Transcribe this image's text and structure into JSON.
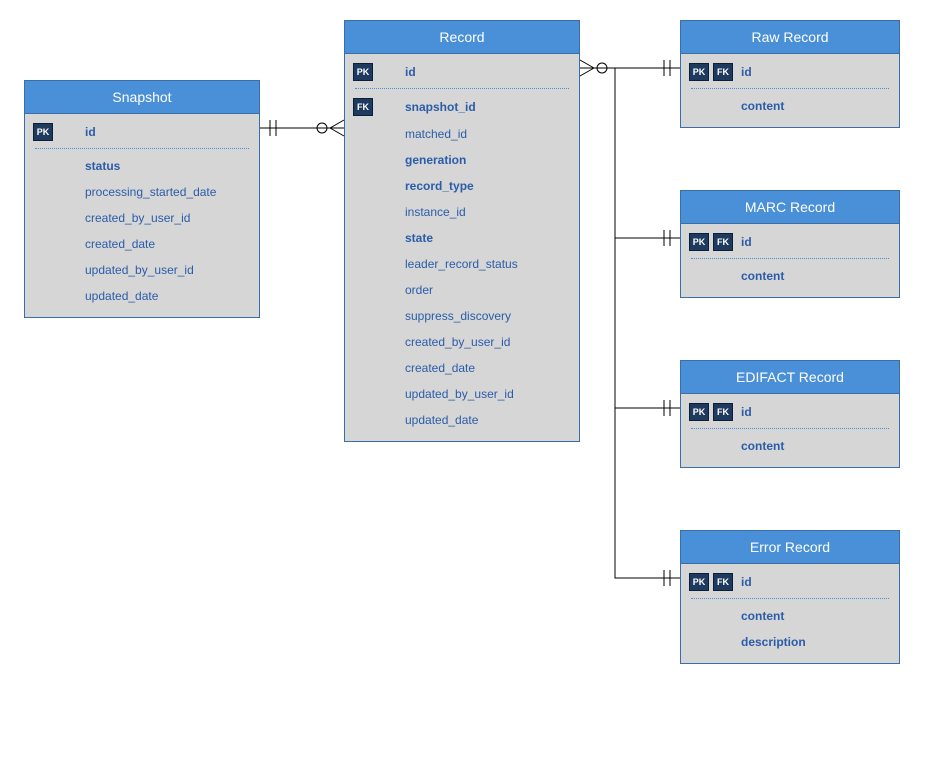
{
  "entities": {
    "snapshot": {
      "title": "Snapshot",
      "fields": [
        {
          "keys": [
            "PK"
          ],
          "name": "id",
          "bold": true
        },
        {
          "sep": true
        },
        {
          "keys": [],
          "name": "status",
          "bold": true
        },
        {
          "keys": [],
          "name": "processing_started_date",
          "bold": false
        },
        {
          "keys": [],
          "name": "created_by_user_id",
          "bold": false
        },
        {
          "keys": [],
          "name": "created_date",
          "bold": false
        },
        {
          "keys": [],
          "name": "updated_by_user_id",
          "bold": false
        },
        {
          "keys": [],
          "name": "updated_date",
          "bold": false
        }
      ]
    },
    "record": {
      "title": "Record",
      "fields": [
        {
          "keys": [
            "PK"
          ],
          "name": "id",
          "bold": true
        },
        {
          "sep": true
        },
        {
          "keys": [
            "FK"
          ],
          "name": "snapshot_id",
          "bold": true
        },
        {
          "keys": [],
          "name": "matched_id",
          "bold": false
        },
        {
          "keys": [],
          "name": "generation",
          "bold": true
        },
        {
          "keys": [],
          "name": "record_type",
          "bold": true
        },
        {
          "keys": [],
          "name": "instance_id",
          "bold": false
        },
        {
          "keys": [],
          "name": "state",
          "bold": true
        },
        {
          "keys": [],
          "name": "leader_record_status",
          "bold": false
        },
        {
          "keys": [],
          "name": "order",
          "bold": false
        },
        {
          "keys": [],
          "name": "suppress_discovery",
          "bold": false
        },
        {
          "keys": [],
          "name": "created_by_user_id",
          "bold": false
        },
        {
          "keys": [],
          "name": "created_date",
          "bold": false
        },
        {
          "keys": [],
          "name": "updated_by_user_id",
          "bold": false
        },
        {
          "keys": [],
          "name": "updated_date",
          "bold": false
        }
      ]
    },
    "raw": {
      "title": "Raw Record",
      "fields": [
        {
          "keys": [
            "PK",
            "FK"
          ],
          "name": "id",
          "bold": true
        },
        {
          "sep": true
        },
        {
          "keys": [],
          "name": "content",
          "bold": true
        }
      ]
    },
    "marc": {
      "title": "MARC Record",
      "fields": [
        {
          "keys": [
            "PK",
            "FK"
          ],
          "name": "id",
          "bold": true
        },
        {
          "sep": true
        },
        {
          "keys": [],
          "name": "content",
          "bold": true
        }
      ]
    },
    "edifact": {
      "title": "EDIFACT Record",
      "fields": [
        {
          "keys": [
            "PK",
            "FK"
          ],
          "name": "id",
          "bold": true
        },
        {
          "sep": true
        },
        {
          "keys": [],
          "name": "content",
          "bold": true
        }
      ]
    },
    "error": {
      "title": "Error Record",
      "fields": [
        {
          "keys": [
            "PK",
            "FK"
          ],
          "name": "id",
          "bold": true
        },
        {
          "sep": true
        },
        {
          "keys": [],
          "name": "content",
          "bold": true
        },
        {
          "keys": [],
          "name": "description",
          "bold": true
        }
      ]
    }
  },
  "key_labels": {
    "PK": "PK",
    "FK": "FK"
  }
}
